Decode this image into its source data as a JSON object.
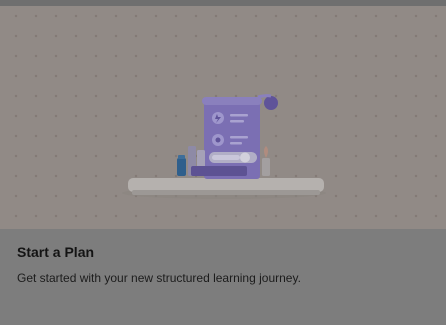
{
  "card": {
    "title": "Start a Plan",
    "description": "Get started with your new structured learning journey."
  },
  "colors": {
    "card_background": "#8c8c8c",
    "hero_background": "#918a86",
    "illustration_accent": "#7b6fb3"
  },
  "illustration": {
    "icon": "learning-plan-document-illustration"
  }
}
